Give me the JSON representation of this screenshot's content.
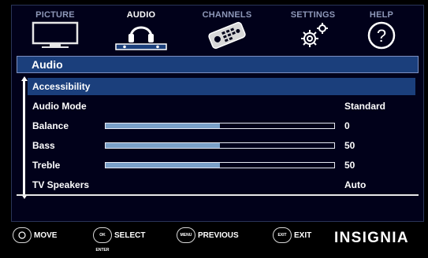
{
  "tabs": [
    {
      "label": "PICTURE",
      "icon": "tv-icon",
      "active": false
    },
    {
      "label": "AUDIO",
      "icon": "headphones-icon",
      "active": true
    },
    {
      "label": "CHANNELS",
      "icon": "remote-icon",
      "active": false
    },
    {
      "label": "SETTINGS",
      "icon": "gears-icon",
      "active": false
    },
    {
      "label": "HELP",
      "icon": "question-icon",
      "active": false
    }
  ],
  "panel": {
    "title": "Audio",
    "rows": [
      {
        "label": "Accessibility",
        "value": "",
        "selected": true
      },
      {
        "label": "Audio Mode",
        "value": "Standard"
      },
      {
        "label": "Balance",
        "value": "0",
        "level": 0.5
      },
      {
        "label": "Bass",
        "value": "50",
        "level": 0.5
      },
      {
        "label": "Treble",
        "value": "50",
        "level": 0.5
      },
      {
        "label": "TV Speakers",
        "value": "Auto"
      }
    ]
  },
  "footer": {
    "move": {
      "button": "",
      "label": "MOVE"
    },
    "select": {
      "button": "OK ENTER",
      "label": "SELECT"
    },
    "previous": {
      "button": "MENU",
      "label": "PREVIOUS"
    },
    "exit": {
      "button": "EXIT",
      "label": "EXIT"
    },
    "brand": "INSIGNIA"
  },
  "colors": {
    "selection": "#1b3f7c",
    "slider_fill": "#7aa0c8",
    "background": "#01011a"
  }
}
